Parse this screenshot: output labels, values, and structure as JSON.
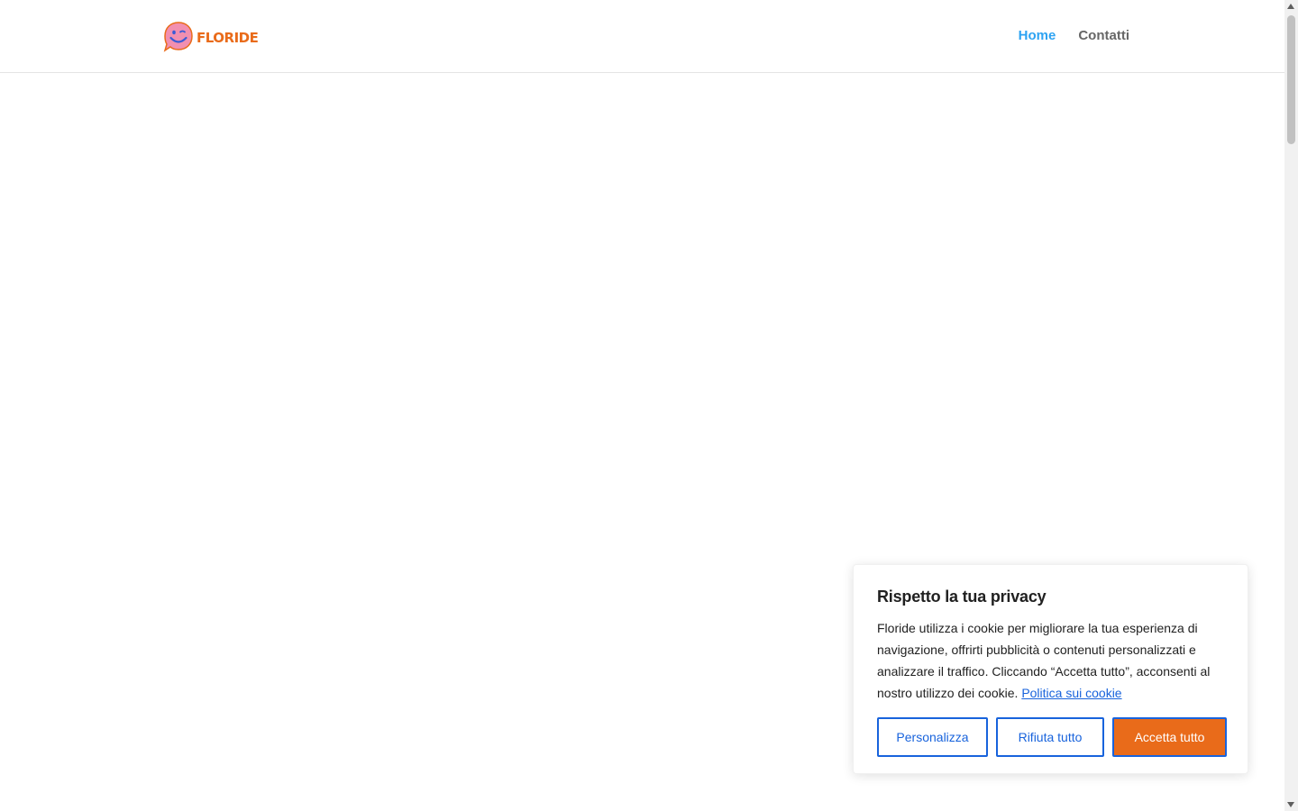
{
  "header": {
    "logo_text": "FLORIDE",
    "nav": [
      {
        "label": "Home",
        "active": true
      },
      {
        "label": "Contatti",
        "active": false
      }
    ]
  },
  "cookie_banner": {
    "title": "Rispetto la tua privacy",
    "body": "Floride utilizza i cookie per migliorare la tua esperienza di navigazione, offrirti pubblicità o contenuti personalizzati e analizzare il  traffico. Cliccando “Accetta tutto”, acconsenti al nostro utilizzo dei cookie.",
    "policy_link": "Politica sui cookie",
    "buttons": {
      "customize": "Personalizza",
      "reject": "Rifiuta tutto",
      "accept": "Accetta tutto"
    }
  },
  "colors": {
    "nav_active": "#2ea3f2",
    "nav_inactive": "#666666",
    "logo_orange": "#e96b1a",
    "logo_pink": "#f28fb0",
    "logo_face": "#3b5bd6",
    "button_accent": "#1863dc",
    "accept_bg": "#e96b1a"
  },
  "icons": {
    "logo_mark": "smiley-chat-bubble-icon",
    "scroll_up": "scroll-up-arrow-icon",
    "scroll_down": "scroll-down-arrow-icon"
  }
}
